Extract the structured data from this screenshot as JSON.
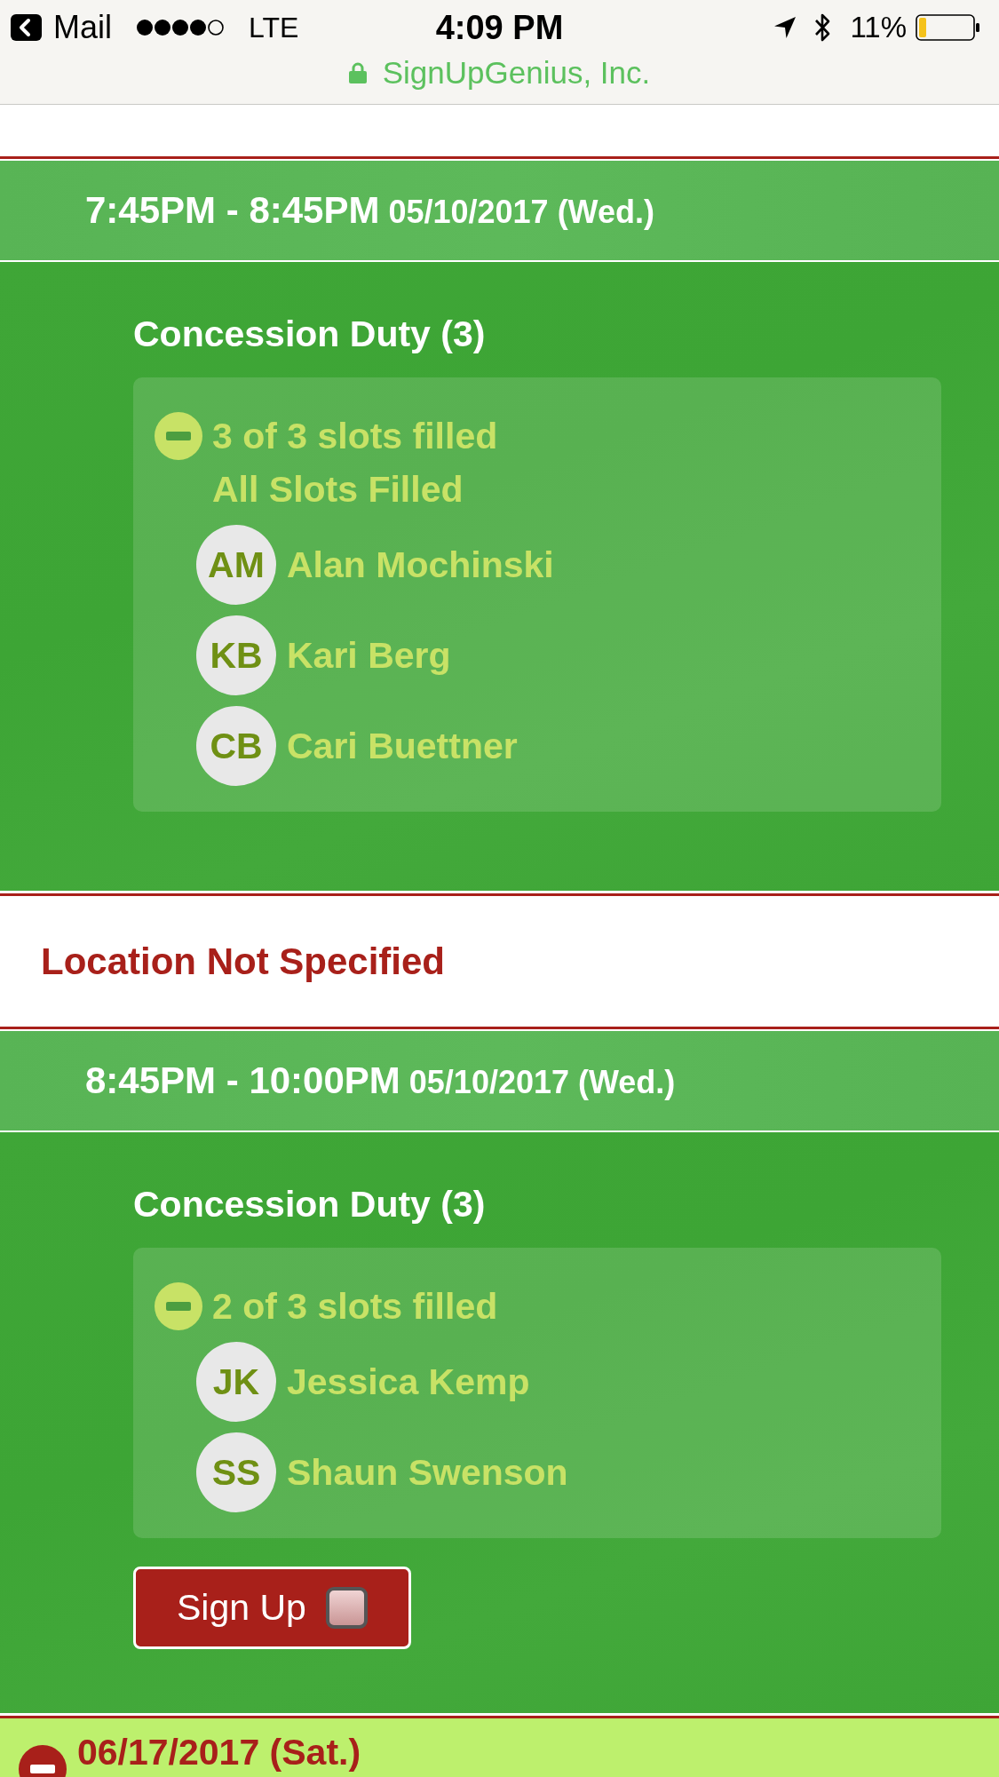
{
  "status_bar": {
    "back_label": "Mail",
    "network": "LTE",
    "time": "4:09 PM",
    "battery": "11%"
  },
  "address_bar": {
    "secure": true,
    "site": "SignUpGenius, Inc."
  },
  "sections": [
    {
      "kind": "timeslot",
      "time": "7:45PM - 8:45PM",
      "date": "05/10/2017 (Wed.)",
      "slots": [
        {
          "title": "Concession Duty (3)",
          "expanded": true,
          "summary": "3 of 3 slots filled",
          "note": "All Slots Filled",
          "people": [
            {
              "initials": "AM",
              "name": "Alan Mochinski"
            },
            {
              "initials": "KB",
              "name": "Kari Berg"
            },
            {
              "initials": "CB",
              "name": "Cari Buettner"
            }
          ]
        }
      ]
    },
    {
      "kind": "location",
      "label": "Location Not Specified"
    },
    {
      "kind": "timeslot",
      "time": "8:45PM - 10:00PM",
      "date": "05/10/2017 (Wed.)",
      "slots": [
        {
          "title": "Concession Duty (3)",
          "expanded": true,
          "summary": "2 of 3 slots filled",
          "people": [
            {
              "initials": "JK",
              "name": "Jessica Kemp"
            },
            {
              "initials": "SS",
              "name": "Shaun Swenson"
            }
          ],
          "sign_up": {
            "label": "Sign Up",
            "checked": false
          }
        }
      ]
    },
    {
      "kind": "day",
      "label": "06/17/2017 (Sat.)",
      "expanded": true
    }
  ]
}
